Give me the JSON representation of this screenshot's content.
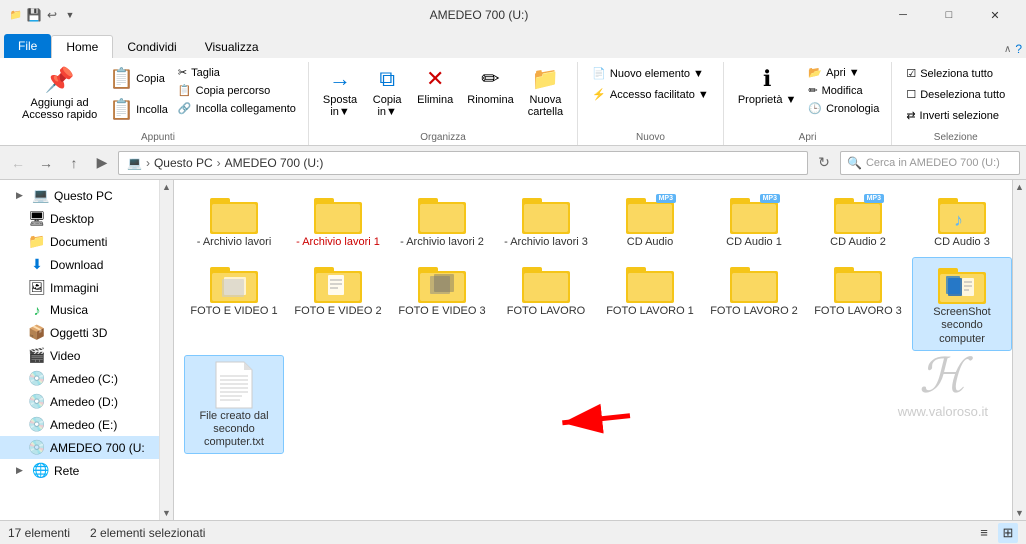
{
  "titlebar": {
    "title": "AMEDEO 700 (U:)",
    "minimize": "─",
    "maximize": "□",
    "close": "✕"
  },
  "ribbon": {
    "tabs": [
      "File",
      "Home",
      "Condividi",
      "Visualizza"
    ],
    "active_tab": "Home",
    "groups": {
      "appunti": {
        "label": "Appunti",
        "buttons": [
          "Aggiungi ad Accesso rapido",
          "Copia",
          "Incolla"
        ],
        "small": [
          "Taglia",
          "Copia percorso",
          "Incolla collegamento"
        ]
      },
      "organizza": {
        "label": "Organizza",
        "buttons": [
          "Sposta in",
          "Copia in",
          "Elimina",
          "Rinomina",
          "Nuova cartella"
        ]
      },
      "nuovo": {
        "label": "Nuovo",
        "buttons": [
          "Nuovo elemento",
          "Accesso facilitato"
        ]
      },
      "apri": {
        "label": "Apri",
        "buttons": [
          "Apri",
          "Modifica",
          "Cronologia",
          "Proprietà"
        ]
      },
      "selezione": {
        "label": "Selezione",
        "buttons": [
          "Seleziona tutto",
          "Deseleziona tutto",
          "Inverti selezione"
        ]
      }
    }
  },
  "addressbar": {
    "path": [
      "Questo PC",
      "AMEDEO 700 (U:)"
    ],
    "search_placeholder": "Cerca in AMEDEO 700 (U:)"
  },
  "sidebar": {
    "items": [
      {
        "label": "Questo PC",
        "icon": "💻",
        "indent": 0,
        "expand": "▶"
      },
      {
        "label": "Desktop",
        "icon": "🖥",
        "indent": 1
      },
      {
        "label": "Documenti",
        "icon": "📁",
        "indent": 1
      },
      {
        "label": "Download",
        "icon": "⬇",
        "indent": 1
      },
      {
        "label": "Immagini",
        "icon": "🖼",
        "indent": 1
      },
      {
        "label": "Musica",
        "icon": "♪",
        "indent": 1
      },
      {
        "label": "Oggetti 3D",
        "icon": "📦",
        "indent": 1
      },
      {
        "label": "Video",
        "icon": "🎬",
        "indent": 1
      },
      {
        "label": "Amedeo (C:)",
        "icon": "💾",
        "indent": 1
      },
      {
        "label": "Amedeo (D:)",
        "icon": "💾",
        "indent": 1
      },
      {
        "label": "Amedeo (E:)",
        "icon": "💾",
        "indent": 1
      },
      {
        "label": "AMEDEO 700 (U:",
        "icon": "💾",
        "indent": 1
      },
      {
        "label": "Rete",
        "icon": "🌐",
        "indent": 0
      }
    ]
  },
  "files": [
    {
      "name": "- Archivio lavori",
      "type": "folder",
      "selected": false
    },
    {
      "name": "- Archivio lavori 1",
      "type": "folder",
      "selected": false,
      "name_color": "red"
    },
    {
      "name": "- Archivio lavori 2",
      "type": "folder",
      "selected": false
    },
    {
      "name": "- Archivio lavori 3",
      "type": "folder",
      "selected": false
    },
    {
      "name": "CD Audio",
      "type": "folder_mp3",
      "selected": false
    },
    {
      "name": "CD Audio 1",
      "type": "folder_mp3",
      "selected": false
    },
    {
      "name": "CD Audio 2",
      "type": "folder_mp3",
      "selected": false
    },
    {
      "name": "CD Audio 3",
      "type": "folder_music",
      "selected": false
    },
    {
      "name": "FOTO E VIDEO 1",
      "type": "folder_photo",
      "selected": false
    },
    {
      "name": "FOTO E VIDEO 2",
      "type": "folder_doc",
      "selected": false
    },
    {
      "name": "FOTO E VIDEO 3",
      "type": "folder_photo2",
      "selected": false
    },
    {
      "name": "FOTO LAVORO",
      "type": "folder",
      "selected": false
    },
    {
      "name": "FOTO LAVORO 1",
      "type": "folder",
      "selected": false
    },
    {
      "name": "FOTO LAVORO 2",
      "type": "folder",
      "selected": false
    },
    {
      "name": "FOTO LAVORO 3",
      "type": "folder",
      "selected": false
    },
    {
      "name": "ScreenShot secondo computer",
      "type": "folder_screenshot",
      "selected": true
    },
    {
      "name": "File creato dal secondo computer.txt",
      "type": "file_txt",
      "selected": true
    }
  ],
  "statusbar": {
    "count": "17 elementi",
    "selected": "2 elementi selezionati"
  },
  "watermark": {
    "symbol": "ℋ",
    "url": "www.valoroso.it"
  }
}
